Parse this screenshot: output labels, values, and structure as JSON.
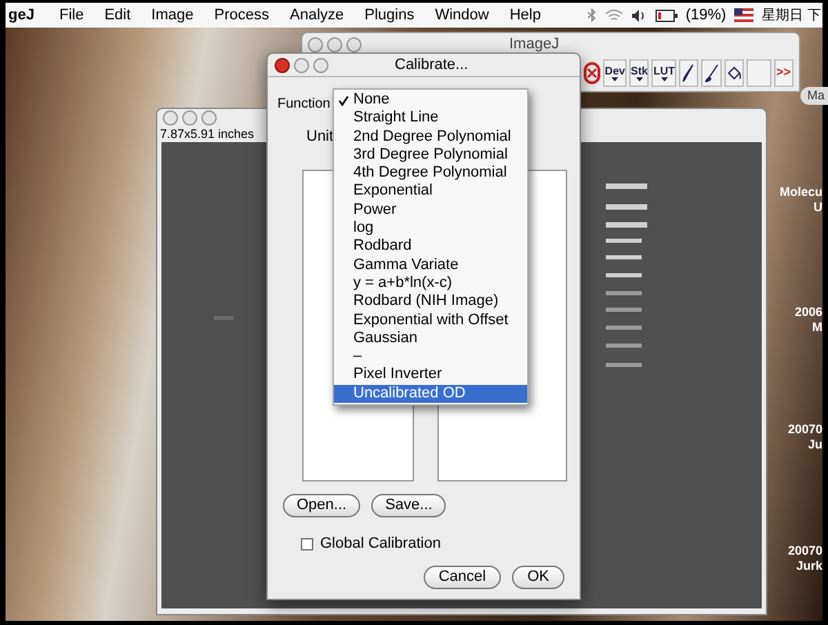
{
  "menu_bar": {
    "app_name": "geJ",
    "items": [
      "File",
      "Edit",
      "Image",
      "Process",
      "Analyze",
      "Plugins",
      "Window",
      "Help"
    ],
    "battery": "(19%)",
    "clock": "星期日 下"
  },
  "imagej_window": {
    "title": "ImageJ",
    "active": false,
    "tools": [
      {
        "kind": "close"
      },
      {
        "kind": "menu",
        "label": "Dev"
      },
      {
        "kind": "menu",
        "label": "Stk"
      },
      {
        "kind": "menu",
        "label": "LUT"
      },
      {
        "kind": "pencil"
      },
      {
        "kind": "brush"
      },
      {
        "kind": "fill"
      },
      {
        "kind": "blank"
      },
      {
        "kind": "more",
        "label": ">>"
      }
    ]
  },
  "image_window": {
    "active": false,
    "info": "7.87x5.91 inches"
  },
  "desktop_button": "Ma",
  "desktop_icons": [
    {
      "lines": [
        "Molecu",
        "U"
      ]
    },
    {
      "lines": [
        "2006",
        "M"
      ]
    },
    {
      "lines": [
        "20070",
        "Ju"
      ]
    },
    {
      "lines": [
        "20070",
        "Jurk"
      ]
    }
  ],
  "dialog": {
    "title": "Calibrate...",
    "active": true,
    "function_label": "Function",
    "unit_label": "Unit",
    "buttons": [
      "Open...",
      "Save..."
    ],
    "global_calibration": {
      "label": "Global Calibration",
      "checked": false
    },
    "footer_buttons": [
      {
        "label": "Cancel",
        "default": false
      },
      {
        "label": "OK",
        "default": false
      }
    ]
  },
  "function_menu": [
    {
      "label": "None",
      "checked": true,
      "selected": false
    },
    {
      "label": "Straight Line",
      "checked": false,
      "selected": false
    },
    {
      "label": "2nd Degree Polynomial",
      "checked": false,
      "selected": false
    },
    {
      "label": "3rd Degree Polynomial",
      "checked": false,
      "selected": false
    },
    {
      "label": "4th Degree Polynomial",
      "checked": false,
      "selected": false
    },
    {
      "label": "Exponential",
      "checked": false,
      "selected": false
    },
    {
      "label": "Power",
      "checked": false,
      "selected": false
    },
    {
      "label": "log",
      "checked": false,
      "selected": false
    },
    {
      "label": "Rodbard",
      "checked": false,
      "selected": false
    },
    {
      "label": "Gamma Variate",
      "checked": false,
      "selected": false
    },
    {
      "label": "y = a+b*ln(x-c)",
      "checked": false,
      "selected": false
    },
    {
      "label": "Rodbard (NIH Image)",
      "checked": false,
      "selected": false
    },
    {
      "label": "Exponential with Offset",
      "checked": false,
      "selected": false
    },
    {
      "label": "Gaussian",
      "checked": false,
      "selected": false
    },
    {
      "label": "–",
      "checked": false,
      "selected": false
    },
    {
      "label": "Pixel Inverter",
      "checked": false,
      "selected": false
    },
    {
      "label": "Uncalibrated OD",
      "checked": false,
      "selected": true
    }
  ]
}
